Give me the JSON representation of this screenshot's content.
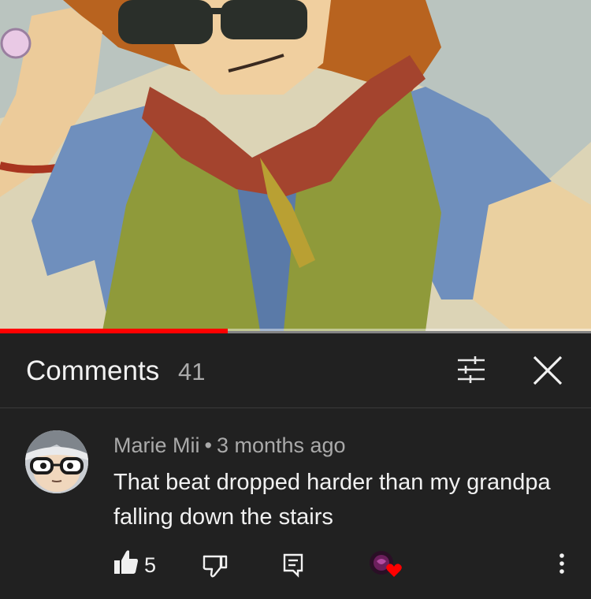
{
  "video": {
    "progress_fraction": 0.385
  },
  "header": {
    "title": "Comments",
    "count": "41",
    "filter_icon": "sort-filter-icon",
    "close_icon": "close-icon"
  },
  "comment": {
    "author": "Marie Mii",
    "separator": "•",
    "time": "3 months ago",
    "text": "That beat dropped harder than my grandpa falling down the stairs",
    "like_count": "5"
  },
  "colors": {
    "background": "#212121",
    "accent": "#ff0000",
    "secondary_text": "#aaaaaa"
  }
}
